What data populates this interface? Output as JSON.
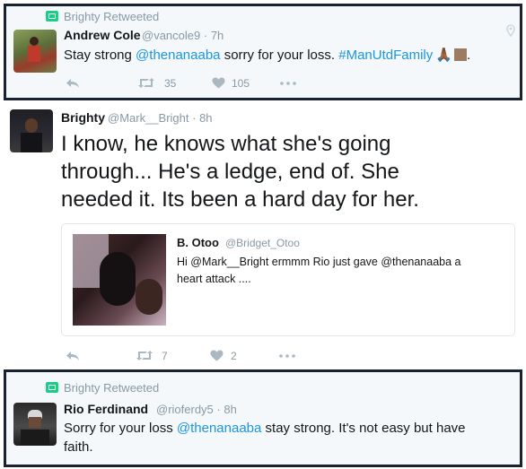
{
  "tweet1": {
    "retweet_label": "Brighty Retweeted",
    "name": "Andrew Cole",
    "handle": "@vancole9",
    "time": "· 7h",
    "text_a": "Stay strong ",
    "mention": "@thenanaaba",
    "text_b": " sorry for your loss. ",
    "hashtag": "#ManUtdFamily",
    "emoji": "🙏🏾",
    "text_end": ".",
    "retweets": "35",
    "likes": "105"
  },
  "tweet2": {
    "name": "Brighty",
    "handle": "@Mark__Bright",
    "time": "· 8h",
    "line1": "I know, he knows what she's going",
    "line2": "through...  He's a ledge, end of. She",
    "line3": "needed it. Its been a hard day for her.",
    "quote": {
      "name": "B. Otoo",
      "handle": "@Bridget_Otoo",
      "text_a": "Hi @Mark__Bright ermmm Rio just gave @thenanaaba a",
      "text_b": "heart attack ...."
    },
    "retweets": "7",
    "likes": "2"
  },
  "tweet3": {
    "retweet_label": "Brighty Retweeted",
    "name": "Rio Ferdinand",
    "handle": "@rioferdy5",
    "time": "· 8h",
    "text_a": "Sorry for your loss ",
    "mention": "@thenanaaba",
    "text_b": " stay strong. It's not easy but have",
    "text_c": "faith."
  },
  "colors": {
    "link": "#1b95e0",
    "retweet_green": "#19cf86",
    "muted": "#8899a6",
    "highlight_border": "#1a2230"
  }
}
